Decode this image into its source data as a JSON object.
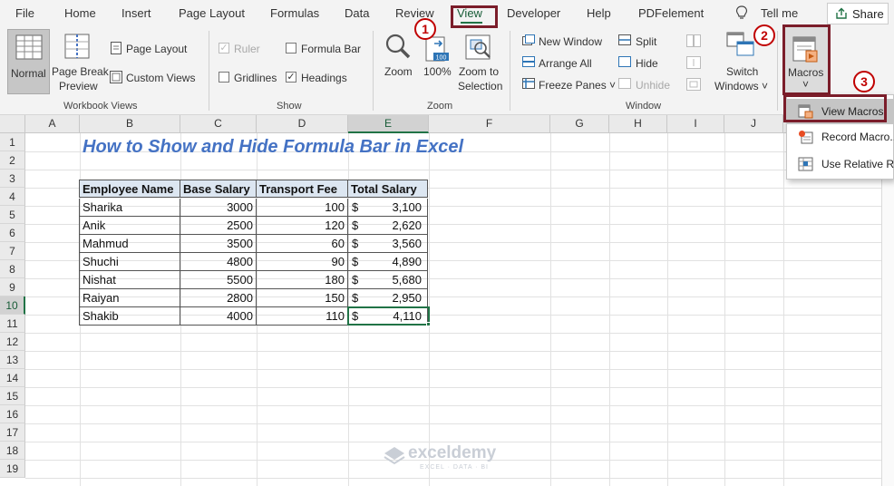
{
  "menu": {
    "tabs": [
      {
        "label": "File",
        "active": false
      },
      {
        "label": "Home",
        "active": false
      },
      {
        "label": "Insert",
        "active": false
      },
      {
        "label": "Page Layout",
        "active": false
      },
      {
        "label": "Formulas",
        "active": false
      },
      {
        "label": "Data",
        "active": false
      },
      {
        "label": "Review",
        "active": false
      },
      {
        "label": "View",
        "active": true
      },
      {
        "label": "Developer",
        "active": false
      },
      {
        "label": "Help",
        "active": false
      },
      {
        "label": "PDFelement",
        "active": false
      }
    ],
    "tell_me": "Tell me",
    "share": "Share"
  },
  "ribbon": {
    "workbook_views": {
      "normal": "Normal",
      "page_break_1": "Page Break",
      "page_break_2": "Preview",
      "page_layout": "Page Layout",
      "custom_views": "Custom Views",
      "group": "Workbook Views"
    },
    "show": {
      "ruler": "Ruler",
      "formula_bar": "Formula Bar",
      "gridlines": "Gridlines",
      "headings": "Headings",
      "ruler_checked": true,
      "formula_bar_checked": false,
      "gridlines_checked": false,
      "headings_checked": true,
      "group": "Show"
    },
    "zoom": {
      "zoom": "Zoom",
      "hundred": "100%",
      "zoom_sel_1": "Zoom to",
      "zoom_sel_2": "Selection",
      "group": "Zoom"
    },
    "window": {
      "new_window": "New Window",
      "arrange_all": "Arrange All",
      "freeze_panes": "Freeze Panes ˅",
      "split": "Split",
      "hide": "Hide",
      "unhide": "Unhide",
      "switch_1": "Switch",
      "switch_2": "Windows ˅",
      "group": "Window"
    },
    "macros": {
      "label": "Macros",
      "arrow": "˅"
    }
  },
  "callouts": [
    "1",
    "2",
    "3"
  ],
  "dropdown": {
    "items": [
      {
        "label": "View Macros",
        "highlighted": true
      },
      {
        "label": "Record Macro...",
        "highlighted": false
      },
      {
        "label": "Use Relative References",
        "highlighted": false
      }
    ]
  },
  "columns": [
    "A",
    "B",
    "C",
    "D",
    "E",
    "F",
    "G",
    "H",
    "I",
    "J"
  ],
  "selected_column": "E",
  "rows": [
    "1",
    "2",
    "3",
    "4",
    "5",
    "6",
    "7",
    "8",
    "9",
    "10",
    "11",
    "12",
    "13",
    "14",
    "15",
    "16",
    "17",
    "18",
    "19"
  ],
  "selected_row": "10",
  "sheet_title": "How to Show and Hide Formula Bar in Excel",
  "table": {
    "headers": [
      "Employee Name",
      "Base Salary",
      "Transport Fee",
      "Total Salary"
    ],
    "rows": [
      {
        "name": "Sharika",
        "base": "3000",
        "fee": "100",
        "currency": "$",
        "total": "3,100"
      },
      {
        "name": "Anik",
        "base": "2500",
        "fee": "120",
        "currency": "$",
        "total": "2,620"
      },
      {
        "name": "Mahmud",
        "base": "3500",
        "fee": "60",
        "currency": "$",
        "total": "3,560"
      },
      {
        "name": "Shuchi",
        "base": "4800",
        "fee": "90",
        "currency": "$",
        "total": "4,890"
      },
      {
        "name": "Nishat",
        "base": "5500",
        "fee": "180",
        "currency": "$",
        "total": "5,680"
      },
      {
        "name": "Raiyan",
        "base": "2800",
        "fee": "150",
        "currency": "$",
        "total": "2,950"
      },
      {
        "name": "Shakib",
        "base": "4000",
        "fee": "110",
        "currency": "$",
        "total": "4,110"
      }
    ]
  },
  "watermark": {
    "name": "exceldemy",
    "tagline": "EXCEL · DATA · BI"
  },
  "colors": {
    "excel_green": "#217346",
    "callout_red": "#c00000",
    "highlight_box": "#7b1d2a",
    "title_blue": "#4472c4",
    "header_fill": "#dce6f1"
  }
}
